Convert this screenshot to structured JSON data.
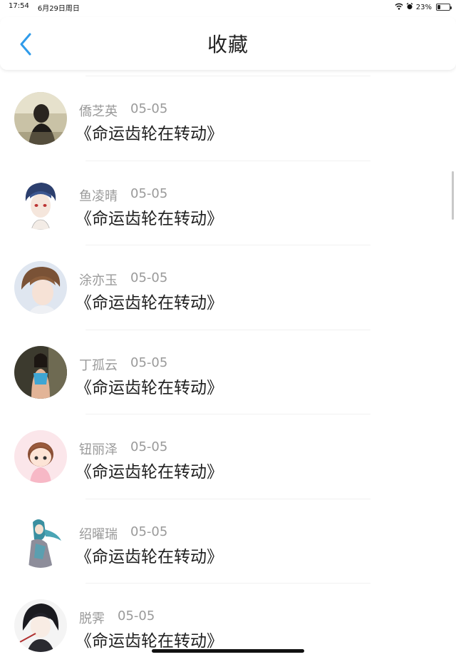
{
  "status_bar": {
    "time": "17:54",
    "date": "6月29日周日",
    "battery_text": "23%",
    "battery_level": 0.23
  },
  "nav": {
    "title": "收藏",
    "back_icon": "chevron-left-icon",
    "accent_color": "#2f9bea"
  },
  "items": [
    {
      "name": "僑芝英",
      "date": "05-05",
      "title": "《命运齿轮在转动》"
    },
    {
      "name": "鱼凌晴",
      "date": "05-05",
      "title": "《命运齿轮在转动》"
    },
    {
      "name": "涂亦玉",
      "date": "05-05",
      "title": "《命运齿轮在转动》"
    },
    {
      "name": "丁孤云",
      "date": "05-05",
      "title": "《命运齿轮在转动》"
    },
    {
      "name": "钮丽泽",
      "date": "05-05",
      "title": "《命运齿轮在转动》"
    },
    {
      "name": "绍曜瑞",
      "date": "05-05",
      "title": "《命运齿轮在转动》"
    },
    {
      "name": "脱霁",
      "date": "05-05",
      "title": "《命运齿轮在转动》"
    }
  ]
}
